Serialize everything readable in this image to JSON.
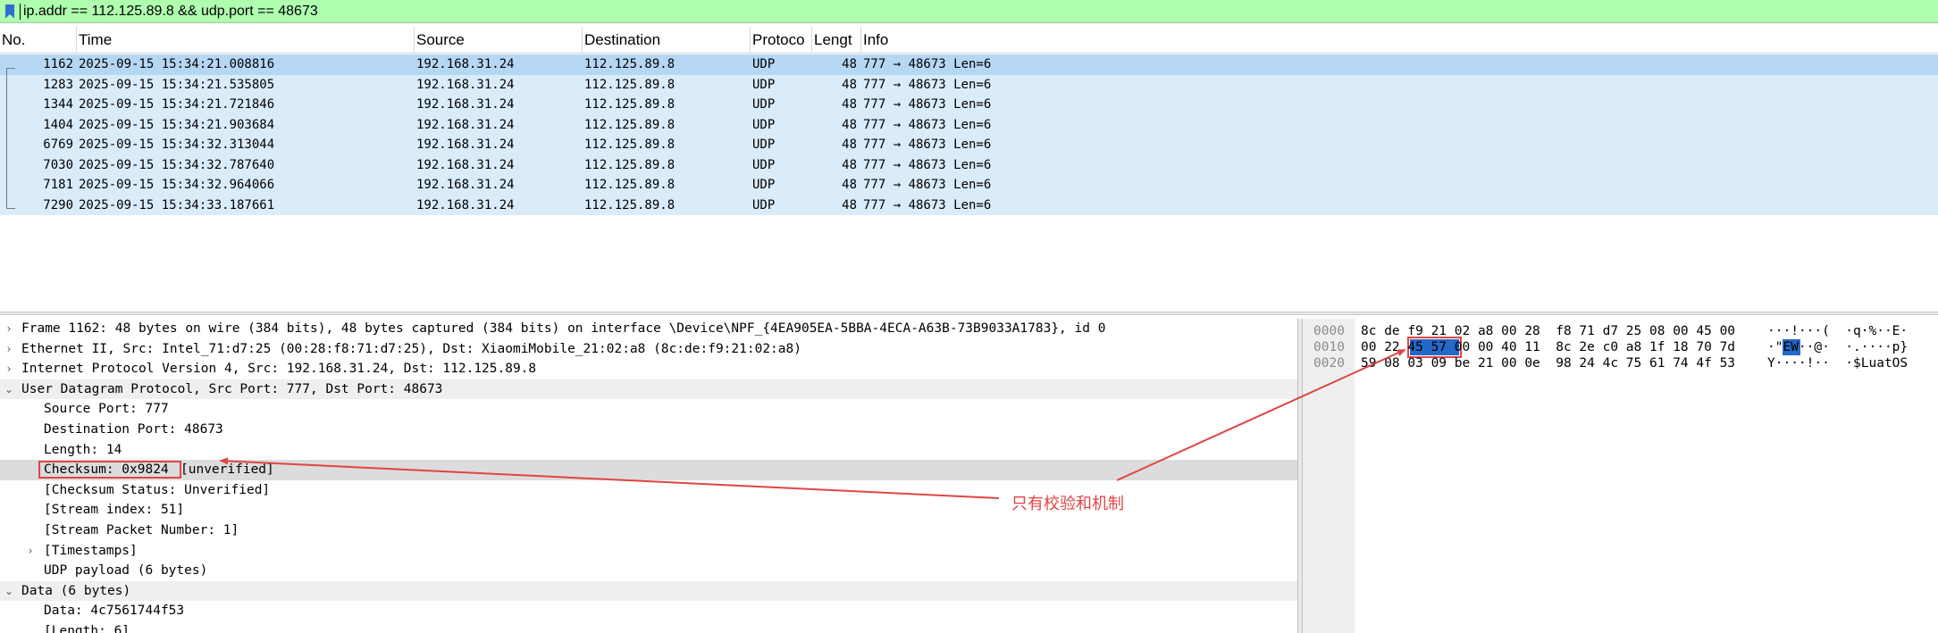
{
  "filter": {
    "value": "ip.addr == 112.125.89.8 && udp.port == 48673"
  },
  "packet_list": {
    "columns": [
      "No.",
      "Time",
      "Source",
      "Destination",
      "Protoco",
      "Lengt",
      "Info"
    ],
    "rows": [
      {
        "no": "1162",
        "time": "2025-09-15 15:34:21.008816",
        "src": "192.168.31.24",
        "dst": "112.125.89.8",
        "proto": "UDP",
        "len": "48",
        "info": "777 → 48673 Len=6"
      },
      {
        "no": "1283",
        "time": "2025-09-15 15:34:21.535805",
        "src": "192.168.31.24",
        "dst": "112.125.89.8",
        "proto": "UDP",
        "len": "48",
        "info": "777 → 48673 Len=6"
      },
      {
        "no": "1344",
        "time": "2025-09-15 15:34:21.721846",
        "src": "192.168.31.24",
        "dst": "112.125.89.8",
        "proto": "UDP",
        "len": "48",
        "info": "777 → 48673 Len=6"
      },
      {
        "no": "1404",
        "time": "2025-09-15 15:34:21.903684",
        "src": "192.168.31.24",
        "dst": "112.125.89.8",
        "proto": "UDP",
        "len": "48",
        "info": "777 → 48673 Len=6"
      },
      {
        "no": "6769",
        "time": "2025-09-15 15:34:32.313044",
        "src": "192.168.31.24",
        "dst": "112.125.89.8",
        "proto": "UDP",
        "len": "48",
        "info": "777 → 48673 Len=6"
      },
      {
        "no": "7030",
        "time": "2025-09-15 15:34:32.787640",
        "src": "192.168.31.24",
        "dst": "112.125.89.8",
        "proto": "UDP",
        "len": "48",
        "info": "777 → 48673 Len=6"
      },
      {
        "no": "7181",
        "time": "2025-09-15 15:34:32.964066",
        "src": "192.168.31.24",
        "dst": "112.125.89.8",
        "proto": "UDP",
        "len": "48",
        "info": "777 → 48673 Len=6"
      },
      {
        "no": "7290",
        "time": "2025-09-15 15:34:33.187661",
        "src": "192.168.31.24",
        "dst": "112.125.89.8",
        "proto": "UDP",
        "len": "48",
        "info": "777 → 48673 Len=6"
      }
    ]
  },
  "details": {
    "rows": [
      {
        "text": "Frame 1162: 48 bytes on wire (384 bits), 48 bytes captured (384 bits) on interface \\Device\\NPF_{4EA905EA-5BBA-4ECA-A63B-73B9033A1783}, id 0",
        "arrow": "›"
      },
      {
        "text": "Ethernet II, Src: Intel_71:d7:25 (00:28:f8:71:d7:25), Dst: XiaomiMobile_21:02:a8 (8c:de:f9:21:02:a8)",
        "arrow": "›"
      },
      {
        "text": "Internet Protocol Version 4, Src: 192.168.31.24, Dst: 112.125.89.8",
        "arrow": "›"
      },
      {
        "text": "User Datagram Protocol, Src Port: 777, Dst Port: 48673",
        "arrow": "⌄"
      },
      {
        "text": "Source Port: 777",
        "arrow": ""
      },
      {
        "text": "Destination Port: 48673",
        "arrow": ""
      },
      {
        "text": "Length: 14",
        "arrow": ""
      },
      {
        "text": "Checksum: 0x9824",
        "suffix": "[unverified]",
        "arrow": ""
      },
      {
        "text": "[Checksum Status: Unverified]",
        "arrow": ""
      },
      {
        "text": "[Stream index: 51]",
        "arrow": ""
      },
      {
        "text": "[Stream Packet Number: 1]",
        "arrow": ""
      },
      {
        "text": "[Timestamps]",
        "arrow": "›"
      },
      {
        "text": "UDP payload (6 bytes)",
        "arrow": ""
      },
      {
        "text": "Data (6 bytes)",
        "arrow": "⌄"
      },
      {
        "text": "Data: 4c7561744f53",
        "arrow": ""
      },
      {
        "text": "[Length: 6]",
        "arrow": ""
      }
    ]
  },
  "bytes": {
    "rows": [
      {
        "offset": "0000",
        "hex": "8c de f9 21 02 a8 00 28  f8 71 d7 25 08 00 45 00",
        "ascii": "···!···(  ·q·%··E·"
      },
      {
        "offset": "0010",
        "hex": "00 22 45 57 00 00 40 11  8c 2e c0 a8 1f 18 70 7d",
        "ascii": "·\"EW··@·  ·.····p}"
      },
      {
        "offset": "0020",
        "hex": "59 08 03 09 be 21 00 0e  98 24 4c 75 61 74 4f 53",
        "ascii": "Y····!··  ·$LuatOS"
      }
    ],
    "highlight_hex": "45 57",
    "highlight_ascii": "EW"
  },
  "annotation": {
    "label": "只有校验和机制"
  },
  "colors": {
    "filter_bg": "#afffaf",
    "row_bg": "#daebfa",
    "row_selected": "#b6d7f4",
    "annotation": "#e04545",
    "byte_highlight": "#2468c8"
  }
}
